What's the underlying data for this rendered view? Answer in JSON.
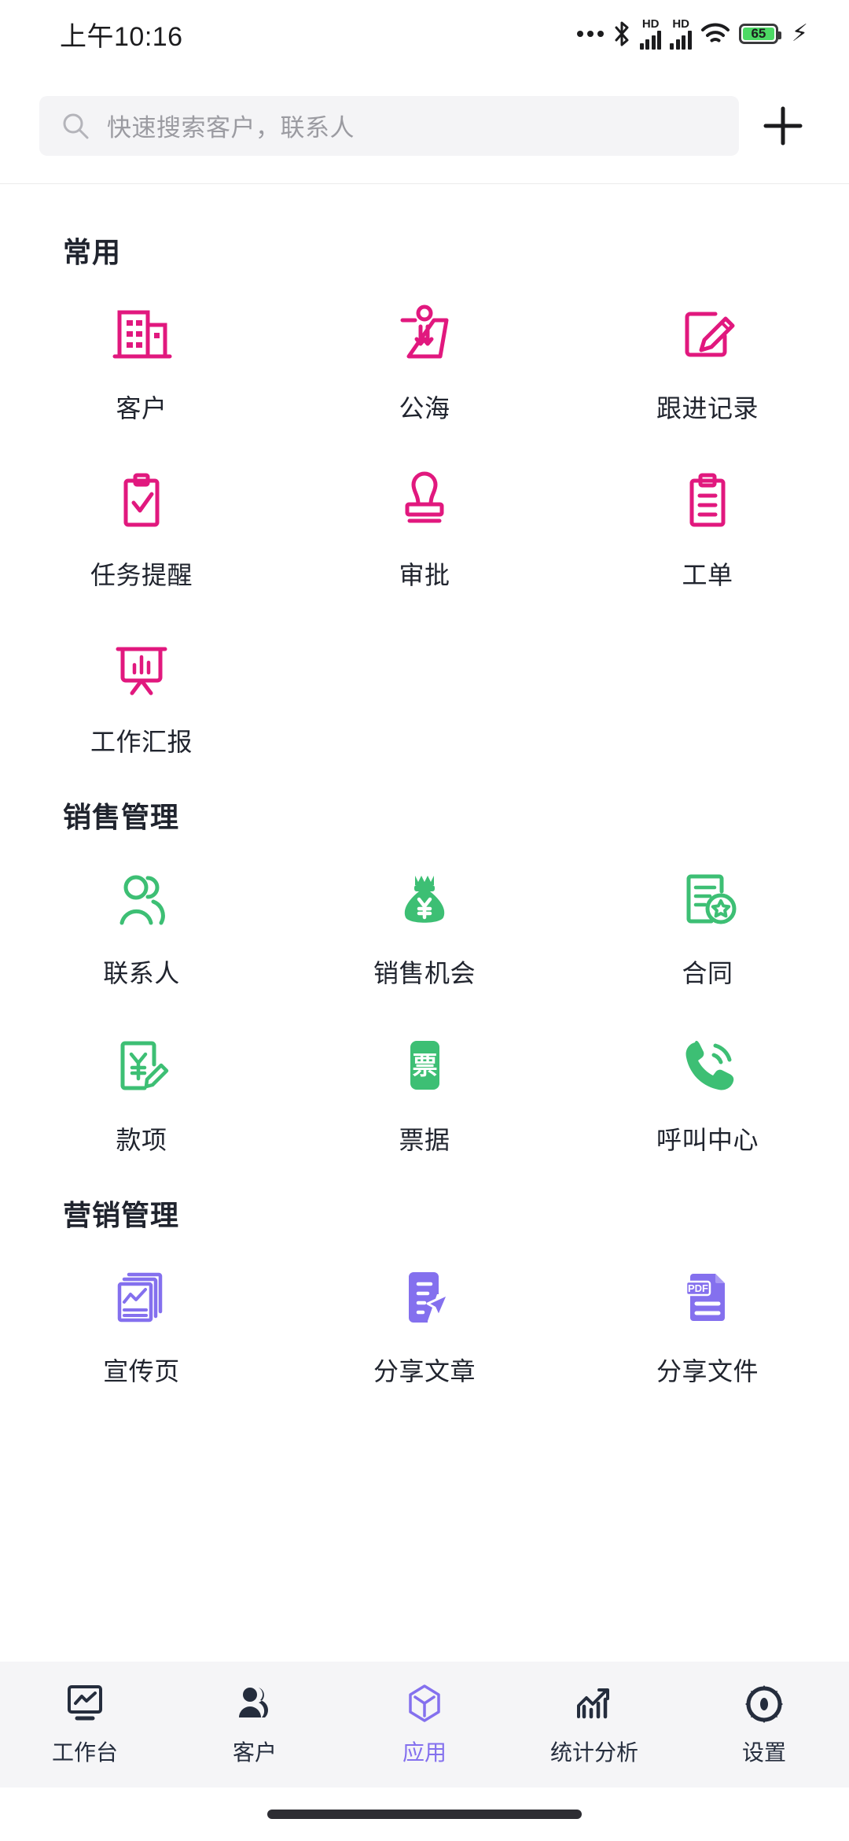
{
  "status_bar": {
    "time": "上午10:16",
    "battery_percent": "65",
    "network_labels": [
      "HD",
      "HD"
    ],
    "icons": [
      "dots-icon",
      "bluetooth-icon",
      "signal-hd-icon",
      "signal-hd-icon",
      "wifi-icon",
      "battery-icon",
      "charging-bolt-icon"
    ]
  },
  "search": {
    "placeholder": "快速搜索客户，联系人",
    "icon": "search-icon",
    "add_icon": "plus-icon"
  },
  "colors": {
    "pink": "#e1187e",
    "green": "#3dbf74",
    "purple": "#8470ee",
    "text": "#20242e",
    "nav_inactive": "#252d3d",
    "nav_bg": "#f5f5f7",
    "search_bg": "#f4f4f6"
  },
  "sections": [
    {
      "title": "常用",
      "color": "#e1187e",
      "items": [
        {
          "label": "客户",
          "icon": "building-icon"
        },
        {
          "label": "公海",
          "icon": "public-pool-icon"
        },
        {
          "label": "跟进记录",
          "icon": "edit-square-icon"
        },
        {
          "label": "任务提醒",
          "icon": "clipboard-check-icon"
        },
        {
          "label": "审批",
          "icon": "stamp-icon"
        },
        {
          "label": "工单",
          "icon": "clipboard-lines-icon"
        },
        {
          "label": "工作汇报",
          "icon": "presentation-chart-icon"
        }
      ]
    },
    {
      "title": "销售管理",
      "color": "#3dbf74",
      "items": [
        {
          "label": "联系人",
          "icon": "people-icon"
        },
        {
          "label": "销售机会",
          "icon": "money-bag-icon"
        },
        {
          "label": "合同",
          "icon": "contract-star-icon"
        },
        {
          "label": "款项",
          "icon": "payment-yen-edit-icon"
        },
        {
          "label": "票据",
          "icon": "invoice-icon"
        },
        {
          "label": "呼叫中心",
          "icon": "phone-call-icon"
        }
      ]
    },
    {
      "title": "营销管理",
      "color": "#8470ee",
      "items": [
        {
          "label": "宣传页",
          "icon": "flyer-chart-icon"
        },
        {
          "label": "分享文章",
          "icon": "share-article-icon"
        },
        {
          "label": "分享文件",
          "icon": "pdf-file-icon"
        }
      ]
    }
  ],
  "bottom_nav": {
    "active_index": 2,
    "items": [
      {
        "label": "工作台",
        "icon": "dashboard-monitor-icon"
      },
      {
        "label": "客户",
        "icon": "customers-people-icon"
      },
      {
        "label": "应用",
        "icon": "apps-cube-icon"
      },
      {
        "label": "统计分析",
        "icon": "analytics-chart-icon"
      },
      {
        "label": "设置",
        "icon": "gear-icon"
      }
    ]
  }
}
